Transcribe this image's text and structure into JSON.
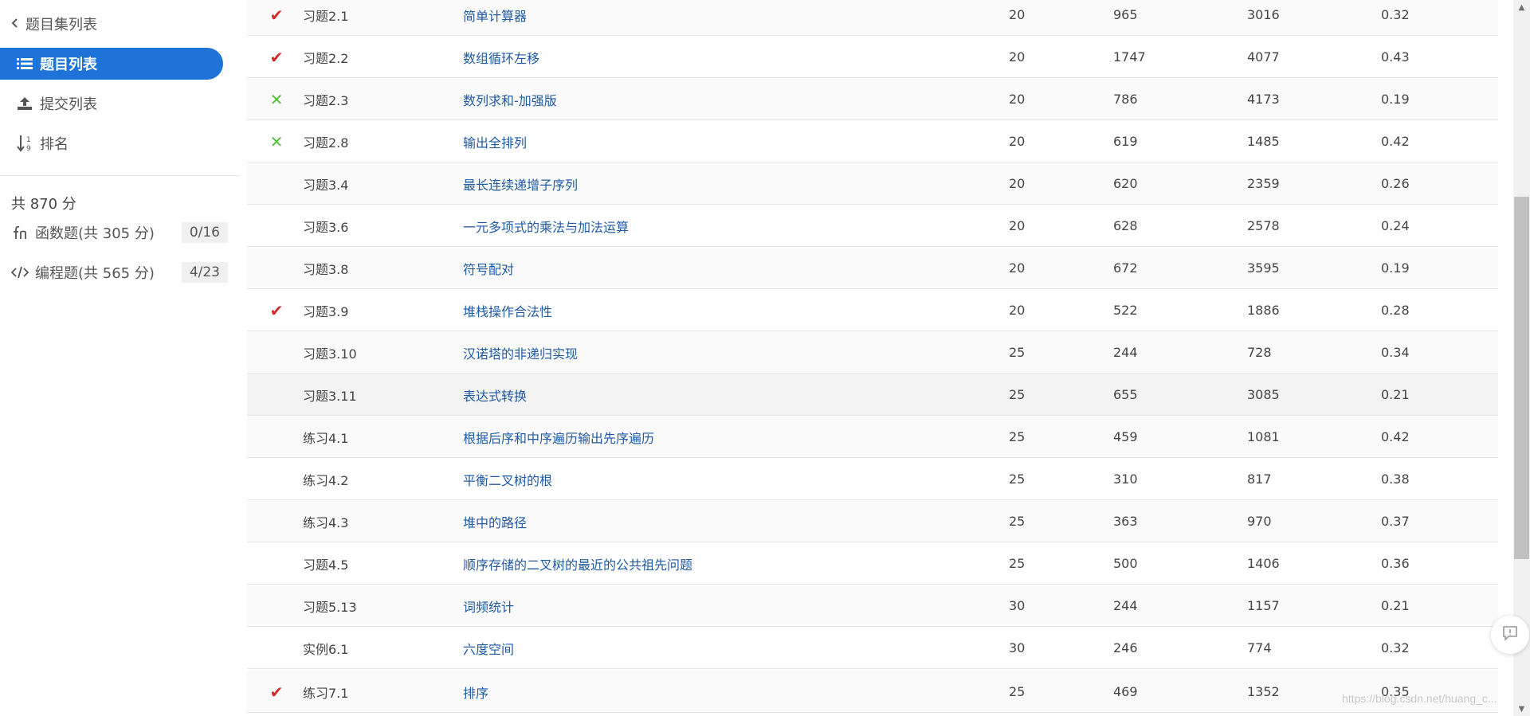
{
  "sidebar": {
    "back_label": "题目集列表",
    "nav": [
      {
        "label": "题目列表",
        "icon": "list-icon",
        "active": true
      },
      {
        "label": "提交列表",
        "icon": "upload-icon",
        "active": false
      },
      {
        "label": "排名",
        "icon": "sort-numeric-icon",
        "active": false
      }
    ],
    "total_score": "共 870 分",
    "categories": [
      {
        "label": "函数题(共 305 分)",
        "icon": "function-icon",
        "progress": "0/16"
      },
      {
        "label": "编程题(共 565 分)",
        "icon": "code-icon",
        "progress": "4/23"
      }
    ],
    "accent_color": "#1e73d8"
  },
  "problems": [
    {
      "status": "correct",
      "status_glyph": "✔",
      "label": "习题2.1",
      "title": "简单计算器",
      "score": "20",
      "ac": "965",
      "submissions": "3016",
      "rate": "0.32"
    },
    {
      "status": "correct",
      "status_glyph": "✔",
      "label": "习题2.2",
      "title": "数组循环左移",
      "score": "20",
      "ac": "1747",
      "submissions": "4077",
      "rate": "0.43"
    },
    {
      "status": "wrong",
      "status_glyph": "✕",
      "label": "习题2.3",
      "title": "数列求和-加强版",
      "score": "20",
      "ac": "786",
      "submissions": "4173",
      "rate": "0.19"
    },
    {
      "status": "wrong",
      "status_glyph": "✕",
      "label": "习题2.8",
      "title": "输出全排列",
      "score": "20",
      "ac": "619",
      "submissions": "1485",
      "rate": "0.42"
    },
    {
      "status": "none",
      "status_glyph": "",
      "label": "习题3.4",
      "title": "最长连续递增子序列",
      "score": "20",
      "ac": "620",
      "submissions": "2359",
      "rate": "0.26"
    },
    {
      "status": "none",
      "status_glyph": "",
      "label": "习题3.6",
      "title": "一元多项式的乘法与加法运算",
      "score": "20",
      "ac": "628",
      "submissions": "2578",
      "rate": "0.24"
    },
    {
      "status": "none",
      "status_glyph": "",
      "label": "习题3.8",
      "title": "符号配对",
      "score": "20",
      "ac": "672",
      "submissions": "3595",
      "rate": "0.19"
    },
    {
      "status": "correct",
      "status_glyph": "✔",
      "label": "习题3.9",
      "title": "堆栈操作合法性",
      "score": "20",
      "ac": "522",
      "submissions": "1886",
      "rate": "0.28"
    },
    {
      "status": "none",
      "status_glyph": "",
      "label": "习题3.10",
      "title": "汉诺塔的非递归实现",
      "score": "25",
      "ac": "244",
      "submissions": "728",
      "rate": "0.34"
    },
    {
      "status": "none",
      "status_glyph": "",
      "label": "习题3.11",
      "title": "表达式转换",
      "score": "25",
      "ac": "655",
      "submissions": "3085",
      "rate": "0.21"
    },
    {
      "status": "none",
      "status_glyph": "",
      "label": "练习4.1",
      "title": "根据后序和中序遍历输出先序遍历",
      "score": "25",
      "ac": "459",
      "submissions": "1081",
      "rate": "0.42"
    },
    {
      "status": "none",
      "status_glyph": "",
      "label": "练习4.2",
      "title": "平衡二叉树的根",
      "score": "25",
      "ac": "310",
      "submissions": "817",
      "rate": "0.38"
    },
    {
      "status": "none",
      "status_glyph": "",
      "label": "练习4.3",
      "title": "堆中的路径",
      "score": "25",
      "ac": "363",
      "submissions": "970",
      "rate": "0.37"
    },
    {
      "status": "none",
      "status_glyph": "",
      "label": "习题4.5",
      "title": "顺序存储的二叉树的最近的公共祖先问题",
      "score": "25",
      "ac": "500",
      "submissions": "1406",
      "rate": "0.36"
    },
    {
      "status": "none",
      "status_glyph": "",
      "label": "习题5.13",
      "title": "词频统计",
      "score": "30",
      "ac": "244",
      "submissions": "1157",
      "rate": "0.21"
    },
    {
      "status": "none",
      "status_glyph": "",
      "label": "实例6.1",
      "title": "六度空间",
      "score": "30",
      "ac": "246",
      "submissions": "774",
      "rate": "0.32"
    },
    {
      "status": "correct",
      "status_glyph": "✔",
      "label": "练习7.1",
      "title": "排序",
      "score": "25",
      "ac": "469",
      "submissions": "1352",
      "rate": "0.35"
    }
  ],
  "colors": {
    "check": "#d42a2a",
    "cross": "#55c23a",
    "link": "#1f5aa6"
  },
  "watermark": "https://blog.csdn.net/huang_c..."
}
